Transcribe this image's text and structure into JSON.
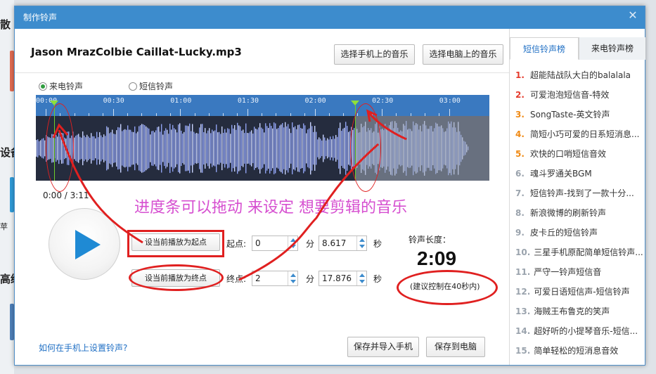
{
  "background": {
    "labels": [
      "散",
      "设备",
      "苹",
      "高级"
    ]
  },
  "dialog": {
    "title": "制作铃声",
    "close_label": "✕"
  },
  "song": {
    "filename": "Jason MrazColbie Caillat-Lucky.mp3"
  },
  "buttons": {
    "select_phone": "选择手机上的音乐",
    "select_pc": "选择电脑上的音乐",
    "set_start": "设当前播放为起点",
    "set_end": "设当前播放为终点",
    "save_import": "保存并导入手机",
    "save_pc": "保存到电脑"
  },
  "ring_type": {
    "options": [
      "来电铃声",
      "短信铃声"
    ],
    "selected": "来电铃声"
  },
  "timeline": {
    "ticks": [
      "00:00",
      "00:30",
      "01:00",
      "01:30",
      "02:00",
      "02:30",
      "03:00"
    ],
    "duration_seconds": 191,
    "start_marker_seconds": 0,
    "end_marker_seconds": 137.9,
    "readout": "0:00 / 3:11"
  },
  "annotation": {
    "text": "进度条可以拖动  来设定 想要剪辑的音乐"
  },
  "start_point": {
    "label": "起点:",
    "minutes": "0",
    "min_unit": "分",
    "seconds": "8.617",
    "sec_unit": "秒"
  },
  "end_point": {
    "label": "终点:",
    "minutes": "2",
    "min_unit": "分",
    "seconds": "17.876",
    "sec_unit": "秒"
  },
  "ring_length": {
    "title": "铃声长度：",
    "value": "2:09",
    "hint": "(建议控制在40秒内)"
  },
  "help_link": "如何在手机上设置铃声?",
  "right_panel": {
    "tabs": [
      "短信铃声榜",
      "来电铃声榜"
    ],
    "active_tab": "短信铃声榜",
    "items": [
      {
        "num": "1.",
        "title": "超能陆战队大白的balalala"
      },
      {
        "num": "2.",
        "title": "可爱泡泡短信音-特效"
      },
      {
        "num": "3.",
        "title": "SongTaste-英文铃声"
      },
      {
        "num": "4.",
        "title": "简短小巧可爱的日系短消息..."
      },
      {
        "num": "5.",
        "title": "欢快的口哨短信音效"
      },
      {
        "num": "6.",
        "title": "魂斗罗通关BGM"
      },
      {
        "num": "7.",
        "title": "短信铃声-找到了一款十分..."
      },
      {
        "num": "8.",
        "title": "新浪微博的刷新铃声"
      },
      {
        "num": "9.",
        "title": "皮卡丘的短信铃声"
      },
      {
        "num": "10.",
        "title": "三星手机原配简单短信铃声..."
      },
      {
        "num": "11.",
        "title": "严守一铃声短信音"
      },
      {
        "num": "12.",
        "title": "可爱日语短信声-短信铃声"
      },
      {
        "num": "13.",
        "title": "海贼王布鲁克的笑声"
      },
      {
        "num": "14.",
        "title": "超好听的小提琴音乐-短信..."
      },
      {
        "num": "15.",
        "title": "简单轻松的短消息音效"
      }
    ]
  },
  "colors": {
    "title_bar": "#3d8ccd",
    "timeline": "#3a79c0",
    "marker": "#6fcd2c",
    "annotation_red": "#e02020",
    "annotation_text": "#d64fd0"
  }
}
